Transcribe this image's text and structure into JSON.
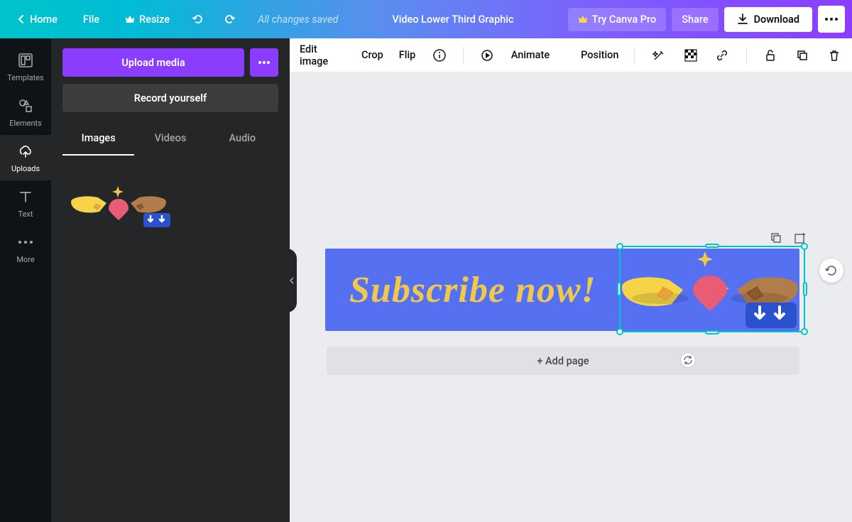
{
  "header": {
    "home": "Home",
    "file": "File",
    "resize": "Resize",
    "status": "All changes saved",
    "title": "Video Lower Third Graphic",
    "try_pro": "Try Canva Pro",
    "share": "Share",
    "download": "Download"
  },
  "rail": {
    "templates": "Templates",
    "elements": "Elements",
    "uploads": "Uploads",
    "text": "Text",
    "more": "More"
  },
  "panel": {
    "upload": "Upload media",
    "record": "Record yourself",
    "tabs": {
      "images": "Images",
      "videos": "Videos",
      "audio": "Audio"
    }
  },
  "toolbar": {
    "edit_image": "Edit image",
    "crop": "Crop",
    "flip": "Flip",
    "animate": "Animate",
    "position": "Position"
  },
  "canvas": {
    "text": "Subscribe now!",
    "add_page": "+ Add page"
  },
  "colors": {
    "accent": "#8b3dff",
    "cyan": "#00c4cc",
    "canvas_bg": "#5570f1",
    "text_fill": "#f0c94a"
  }
}
